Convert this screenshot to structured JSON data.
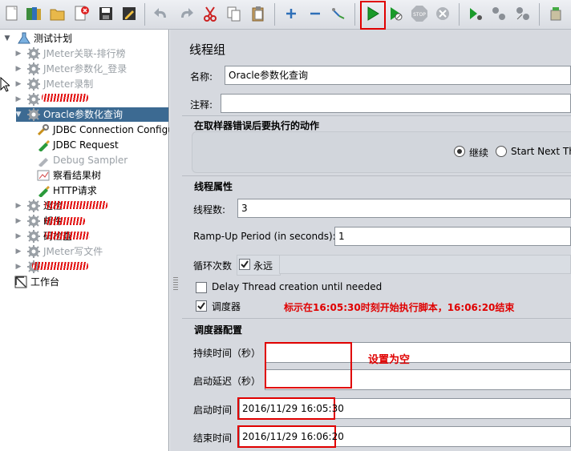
{
  "toolbar": {
    "icons": [
      "new-icon",
      "templates-icon",
      "open-icon",
      "close-icon",
      "save-icon",
      "edit-icon",
      "undo-icon",
      "redo-icon",
      "cut-icon",
      "copy-icon",
      "paste-icon",
      "expand-icon",
      "collapse-icon",
      "toggle-icon",
      "start-icon",
      "start-no-pause-icon",
      "stop-icon",
      "shutdown-icon",
      "remote-start-icon",
      "remote-stop-icon",
      "remote-exit-icon",
      "clear-icon"
    ]
  },
  "tree": {
    "root_label": "测试计划",
    "items": [
      {
        "label": "JMeter关联-排行榜",
        "muted": true
      },
      {
        "label": "JMeter参数化_登录",
        "muted": true
      },
      {
        "label": "JMeter录制",
        "muted": true
      },
      {
        "label": "",
        "muted": false
      },
      {
        "label": "Oracle参数化查询",
        "muted": false,
        "selected": true
      },
      {
        "label": "JDBC Connection Configuration",
        "muted": false
      },
      {
        "label": "JDBC Request",
        "muted": false
      },
      {
        "label": "Debug Sampler",
        "muted": true
      },
      {
        "label": "察看结果树",
        "muted": false
      },
      {
        "label": "HTTP请求",
        "muted": false
      },
      {
        "label": "巡检",
        "muted": false
      },
      {
        "label": "邮件",
        "muted": false
      },
      {
        "label": "码检查",
        "muted": false
      },
      {
        "label": "JMeter写文件",
        "muted": true
      },
      {
        "label": "",
        "muted": false
      }
    ],
    "workbench_label": "工作台"
  },
  "panel": {
    "title": "线程组",
    "name_label": "名称:",
    "name_value": "Oracle参数化查询",
    "comment_label": "注释:",
    "comment_value": "",
    "error_action_title": "在取样器错误后要执行的动作",
    "error_options": [
      "继续",
      "Start Next Thr"
    ],
    "thread_props_title": "线程属性",
    "threads_label": "线程数:",
    "threads_value": "3",
    "rampup_label": "Ramp-Up Period (in seconds):",
    "rampup_value": "1",
    "loop_label": "循环次数",
    "forever_label": "永远",
    "delay_label": "Delay Thread creation until needed",
    "scheduler_label": "调度器",
    "annotation_text": "标示在16:05:30时刻开始执行脚本，16:06:20结束",
    "scheduler_config_title": "调度器配置",
    "duration_label": "持续时间（秒）",
    "startup_delay_label": "启动延迟（秒）",
    "empty_note": "设置为空",
    "start_time_label": "启动时间",
    "start_time_value": "2016/11/29 16:05:30",
    "end_time_label": "结束时间",
    "end_time_value": "2016/11/29 16:06:20"
  },
  "colors": {
    "selection": "#3c6a92",
    "annotation_red": "#e00000",
    "play_green": "#1a9a2a"
  }
}
